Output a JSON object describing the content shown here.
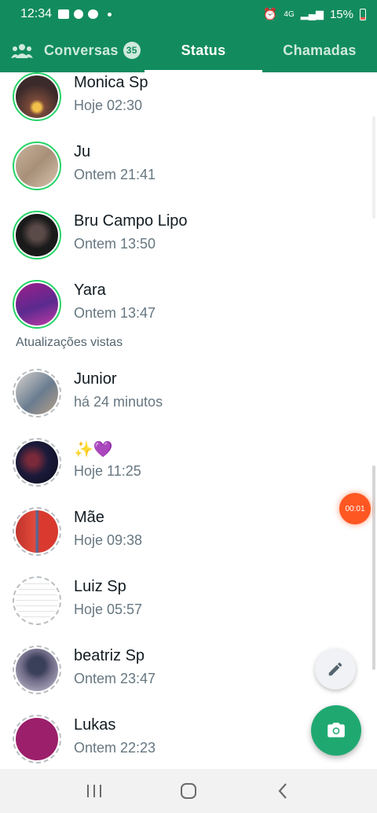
{
  "statusbar": {
    "time": "12:34",
    "battery": "15%",
    "network": "4G"
  },
  "tabs": {
    "conversas": "Conversas",
    "conversas_badge": "35",
    "status": "Status",
    "chamadas": "Chamadas"
  },
  "recent": [
    {
      "name": "Monica Sp",
      "time": "Hoje 02:30"
    },
    {
      "name": "Ju",
      "time": "Ontem 21:41"
    },
    {
      "name": "Bru Campo Lipo",
      "time": "Ontem 13:50"
    },
    {
      "name": "Yara",
      "time": "Ontem 13:47"
    }
  ],
  "viewed_section": "Atualizações vistas",
  "viewed": [
    {
      "name": "Junior",
      "time": "há 24 minutos"
    },
    {
      "name": "✨💜",
      "time": "Hoje 11:25"
    },
    {
      "name": "Mãe",
      "time": "Hoje 09:38"
    },
    {
      "name": "Luiz Sp",
      "time": "Hoje 05:57"
    },
    {
      "name": "beatriz Sp",
      "time": "Ontem 23:47"
    },
    {
      "name": "Lukas",
      "time": "Ontem 22:23"
    }
  ],
  "recording": "00:01",
  "colors": {
    "brand": "#128c5e",
    "ring_unseen": "#25d366",
    "ring_seen": "#b9bec2",
    "fab": "#1fa971",
    "recording": "#ff5722"
  },
  "icons": {
    "community": "community-icon",
    "edit": "pencil-icon",
    "camera": "camera-icon"
  }
}
